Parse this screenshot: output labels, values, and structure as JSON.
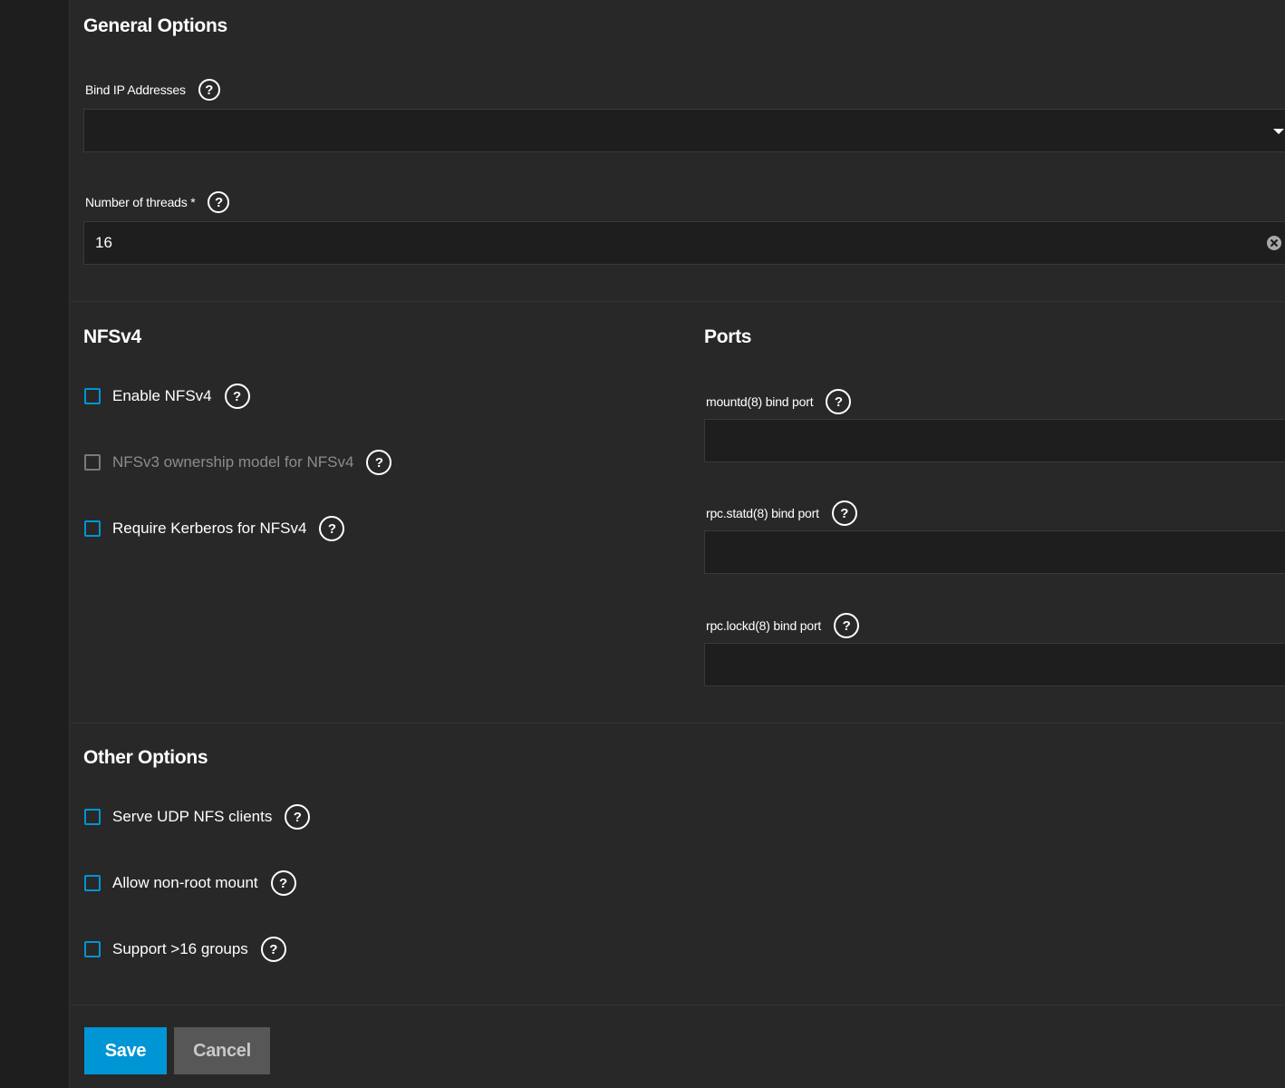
{
  "general": {
    "title": "General Options",
    "bind_ip_label": "Bind IP Addresses",
    "bind_ip_value": "",
    "threads_label": "Number of threads *",
    "threads_value": "16"
  },
  "nfsv4": {
    "title": "NFSv4",
    "options": [
      {
        "label": "Enable NFSv4",
        "checked": false,
        "disabled": false
      },
      {
        "label": "NFSv3 ownership model for NFSv4",
        "checked": false,
        "disabled": true
      },
      {
        "label": "Require Kerberos for NFSv4",
        "checked": false,
        "disabled": false
      }
    ]
  },
  "ports": {
    "title": "Ports",
    "fields": [
      {
        "label": "mountd(8) bind port",
        "value": ""
      },
      {
        "label": "rpc.statd(8) bind port",
        "value": ""
      },
      {
        "label": "rpc.lockd(8) bind port",
        "value": ""
      }
    ]
  },
  "other": {
    "title": "Other Options",
    "options": [
      {
        "label": "Serve UDP NFS clients",
        "checked": false
      },
      {
        "label": "Allow non-root mount",
        "checked": false
      },
      {
        "label": "Support >16 groups",
        "checked": false
      }
    ]
  },
  "actions": {
    "save_label": "Save",
    "cancel_label": "Cancel"
  },
  "colors": {
    "accent": "#0095d5",
    "panel_bg": "#282828",
    "input_bg": "#1e1e1e",
    "cancel_bg": "#575757"
  }
}
